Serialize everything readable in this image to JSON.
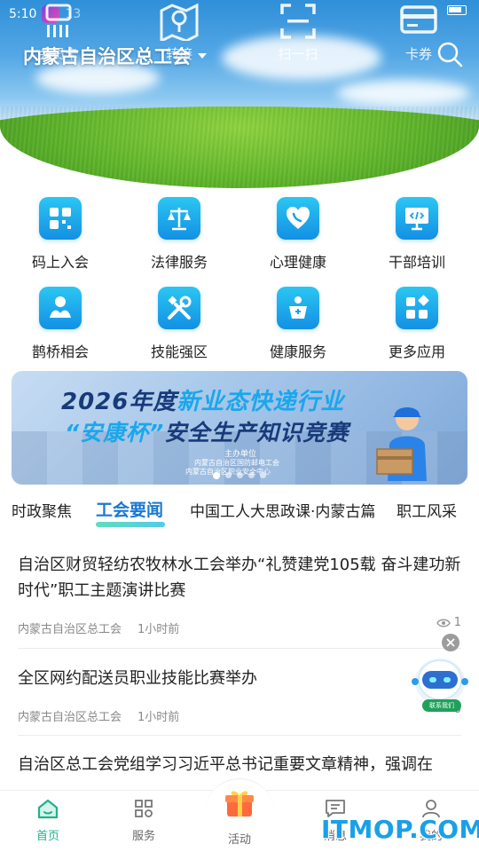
{
  "status_bar": {
    "time": "5:10",
    "extra": "13"
  },
  "header": {
    "org_title": "内蒙古自治区总工会",
    "quick_actions": [
      {
        "icon": "barcode-card-icon",
        "label": "会员卡"
      },
      {
        "icon": "map-pin-icon",
        "label": "转接"
      },
      {
        "icon": "scan-icon",
        "label": "扫一扫"
      },
      {
        "icon": "ticket-card-icon",
        "label": "卡券"
      }
    ]
  },
  "services": [
    {
      "icon": "qr-join-icon",
      "label": "码上入会"
    },
    {
      "icon": "scales-icon",
      "label": "法律服务"
    },
    {
      "icon": "heart-phone-icon",
      "label": "心理健康"
    },
    {
      "icon": "training-screen-icon",
      "label": "干部培训"
    },
    {
      "icon": "matchmaking-icon",
      "label": "鹊桥相会"
    },
    {
      "icon": "tools-icon",
      "label": "技能强区"
    },
    {
      "icon": "health-podium-icon",
      "label": "健康服务"
    },
    {
      "icon": "more-apps-icon",
      "label": "更多应用"
    }
  ],
  "banner": {
    "line1_prefix": "2026年度",
    "line1_highlight": "新业态快递行业",
    "line2_highlight": "“安康杯”",
    "line2_rest": "安全生产知识竞赛",
    "host_label": "主办单位",
    "host_org1": "内蒙古自治区国防邮电工会",
    "host_org2": "内蒙古自治区职业安全中心",
    "slide_count": 5,
    "active_slide": 1
  },
  "tabs": [
    {
      "label": "时政聚焦",
      "active": false
    },
    {
      "label": "工会要闻",
      "active": true
    },
    {
      "label": "中国工人大思政课·内蒙古篇",
      "active": false
    },
    {
      "label": "职工风采",
      "active": false
    }
  ],
  "news": [
    {
      "title": "自治区财贸轻纺农牧林水工会举办“礼赞建党105载 奋斗建功新时代”职工主题演讲比赛",
      "source": "内蒙古自治区总工会",
      "time": "1小时前",
      "views": "1"
    },
    {
      "title": "全区网约配送员职业技能比赛举办",
      "source": "内蒙古自治区总工会",
      "time": "1小时前",
      "views": "0"
    },
    {
      "title": "自治区总工会党组学习习近平总书记重要文章精神，强调在",
      "source": "",
      "time": "",
      "views": ""
    }
  ],
  "floating": {
    "label": "联系我们"
  },
  "bottom_nav": [
    {
      "icon": "home-icon",
      "label": "首页",
      "active": true
    },
    {
      "icon": "services-grid-icon",
      "label": "服务",
      "active": false
    },
    {
      "icon": "gift-icon",
      "label": "活动",
      "active": false
    },
    {
      "icon": "message-icon",
      "label": "消息",
      "active": false
    },
    {
      "icon": "profile-icon",
      "label": "我的",
      "active": false
    }
  ],
  "watermark": "ITMOP.COM",
  "colors": {
    "accent": "#1390e3",
    "active_nav": "#1fb28a",
    "tab_active": "#1a78d2"
  }
}
